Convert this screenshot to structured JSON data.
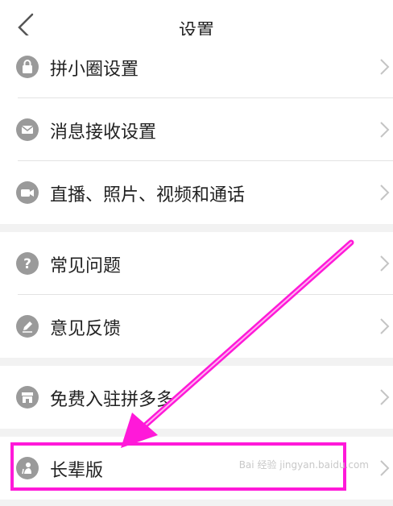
{
  "nav": {
    "title": "设置"
  },
  "group1": [
    {
      "label": "拼小圈设置",
      "icon": "lock-icon"
    },
    {
      "label": "消息接收设置",
      "icon": "envelope-icon"
    },
    {
      "label": "直播、照片、视频和通话",
      "icon": "video-camera-icon"
    }
  ],
  "group2": [
    {
      "label": "常见问题",
      "icon": "question-icon"
    },
    {
      "label": "意见反馈",
      "icon": "pencil-icon"
    }
  ],
  "group3": [
    {
      "label": "免费入驻拼多多",
      "icon": "store-icon"
    }
  ],
  "group4": [
    {
      "label": "长辈版",
      "icon": "elder-person-icon"
    }
  ],
  "watermark": {
    "text": "Bai 经验 jingyan.baidu.com"
  },
  "colors": {
    "annotation": "#ff19d9",
    "icon": "#9a9a9a",
    "separator": "#f2f2f2"
  }
}
